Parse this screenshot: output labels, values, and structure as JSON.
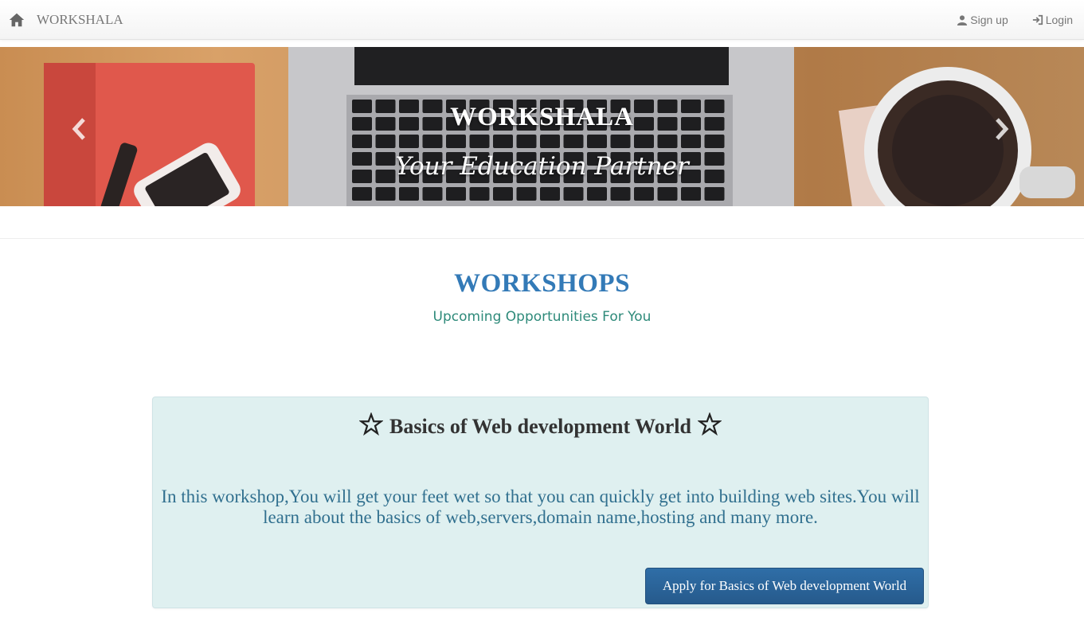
{
  "navbar": {
    "brand": "WORKSHALA",
    "signup_label": "Sign up",
    "login_label": "Login"
  },
  "hero": {
    "title": "WORKSHALA",
    "subtitle": "Your Education Partner"
  },
  "section": {
    "title": "WORKSHOPS",
    "subtitle": "Upcoming Opportunities For You"
  },
  "workshops": [
    {
      "title": "Basics of Web development World",
      "description": "In this workshop,You will get your feet wet so that you can quickly get into building web sites.You will learn about the basics of web,servers,domain name,hosting and many more.",
      "button_label": "Apply for Basics of Web development World"
    }
  ],
  "colors": {
    "accent": "#337ab7",
    "subtitle": "#2e8a7a",
    "card_bg": "#dff0f0",
    "card_text": "#31708f",
    "button": "#2f6ea7"
  }
}
